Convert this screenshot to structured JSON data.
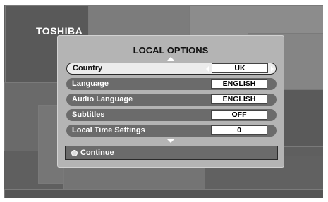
{
  "brand": "TOSHIBA",
  "menu": {
    "title": "LOCAL OPTIONS",
    "items": [
      {
        "label": "Country",
        "value": "UK",
        "selected": true
      },
      {
        "label": "Language",
        "value": "ENGLISH",
        "selected": false
      },
      {
        "label": "Audio Language",
        "value": "ENGLISH",
        "selected": false
      },
      {
        "label": "Subtitles",
        "value": "OFF",
        "selected": false
      },
      {
        "label": "Local Time Settings",
        "value": "0",
        "selected": false
      }
    ],
    "continue_label": "Continue"
  },
  "colors": {
    "panel_bg": "#b4b4b4",
    "row_bg": "#6b6b6b",
    "row_selected_bg": "#ececec",
    "value_bg": "#ffffff"
  }
}
